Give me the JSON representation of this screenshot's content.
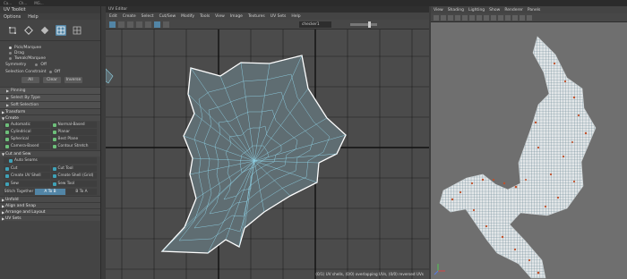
{
  "topbar": {
    "items": [
      "Ca...",
      "Ch...",
      "MG..."
    ]
  },
  "toolkit": {
    "title": "UV Toolkit",
    "menu": [
      "Options",
      "Help"
    ],
    "selection_modes": [
      "Pick/Marquee",
      "Drag",
      "Tweak/Marquee"
    ],
    "symmetry": {
      "label": "Symmetry",
      "value": "Off"
    },
    "selection_constraint": {
      "label": "Selection Constraint",
      "value": "Off"
    },
    "buttons": [
      "All",
      "Clear",
      "Inverse"
    ],
    "sections": {
      "pinning": "Pinning",
      "select_by_type": "Select By Type",
      "soft_selection": "Soft Selection",
      "transform": "Transform",
      "create": "Create",
      "cut_and_sew": "Cut and Sew",
      "unfold": "Unfold",
      "align_and_snap": "Align and Snap",
      "arrange_and_layout": "Arrange and Layout",
      "uv_sets": "UV Sets"
    },
    "create_items": [
      "Automatic",
      "Normal-Based",
      "Cylindrical",
      "Planar",
      "Spherical",
      "Best Plane",
      "Camera-Based",
      "Contour Stretch"
    ],
    "auto_seams": "Auto Seams",
    "cut_items": [
      "Cut",
      "Cut Tool",
      "Create UV Shell",
      "Create Shell (Grid)"
    ],
    "sew_items": [
      "Sew",
      "Sew Tool"
    ],
    "stitch": {
      "label": "Stitch Together",
      "a_to_b": "A To B",
      "b_to_a": "B To A"
    }
  },
  "uv_editor": {
    "title": "UV Editor",
    "menu": [
      "Edit",
      "Create",
      "Select",
      "Cut/Sew",
      "Modify",
      "Tools",
      "View",
      "Image",
      "Textures",
      "UV Sets",
      "Help"
    ],
    "texture": "checker1",
    "status": "(0/1) UV shells, (0/0) overlapping UVs, (0/0) reversed UVs"
  },
  "viewport": {
    "menu": [
      "View",
      "Shading",
      "Lighting",
      "Show",
      "Renderer",
      "Panels"
    ]
  },
  "colors": {
    "uv_wire": "#8fd3e6",
    "selection_blue": "#5285a6",
    "uv_grid_bg": "#4b4b4b",
    "viewport_bg": "#6f6f6f"
  }
}
